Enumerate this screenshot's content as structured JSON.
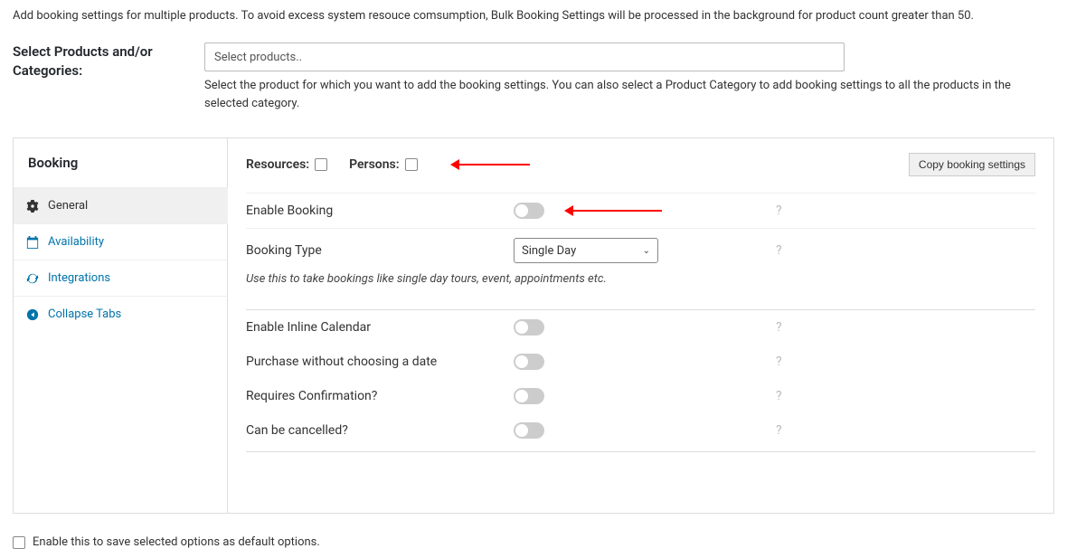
{
  "page_description": "Add booking settings for multiple products. To avoid excess system resouce comsumption, Bulk Booking Settings will be processed in the background for product count greater than 50.",
  "select_section": {
    "label": "Select Products and/or Categories:",
    "placeholder": "Select products..",
    "help": "Select the product for which you want to add the booking settings. You can also select a Product Category to add booking settings to all the products in the selected category."
  },
  "sidebar": {
    "title": "Booking",
    "items": [
      {
        "label": "General",
        "icon": "gear"
      },
      {
        "label": "Availability",
        "icon": "calendar"
      },
      {
        "label": "Integrations",
        "icon": "refresh"
      },
      {
        "label": "Collapse Tabs",
        "icon": "collapse"
      }
    ]
  },
  "header": {
    "resources_label": "Resources:",
    "persons_label": "Persons:",
    "copy_button": "Copy booking settings"
  },
  "form": {
    "enable_booking": {
      "label": "Enable Booking"
    },
    "booking_type": {
      "label": "Booking Type",
      "value": "Single Day",
      "description": "Use this to take bookings like single day tours, event, appointments etc."
    },
    "enable_inline_calendar": {
      "label": "Enable Inline Calendar"
    },
    "purchase_without_date": {
      "label": "Purchase without choosing a date"
    },
    "requires_confirmation": {
      "label": "Requires Confirmation?"
    },
    "can_be_cancelled": {
      "label": "Can be cancelled?"
    }
  },
  "footer": {
    "default_options_label": "Enable this to save selected options as default options."
  },
  "help_icon": "?"
}
